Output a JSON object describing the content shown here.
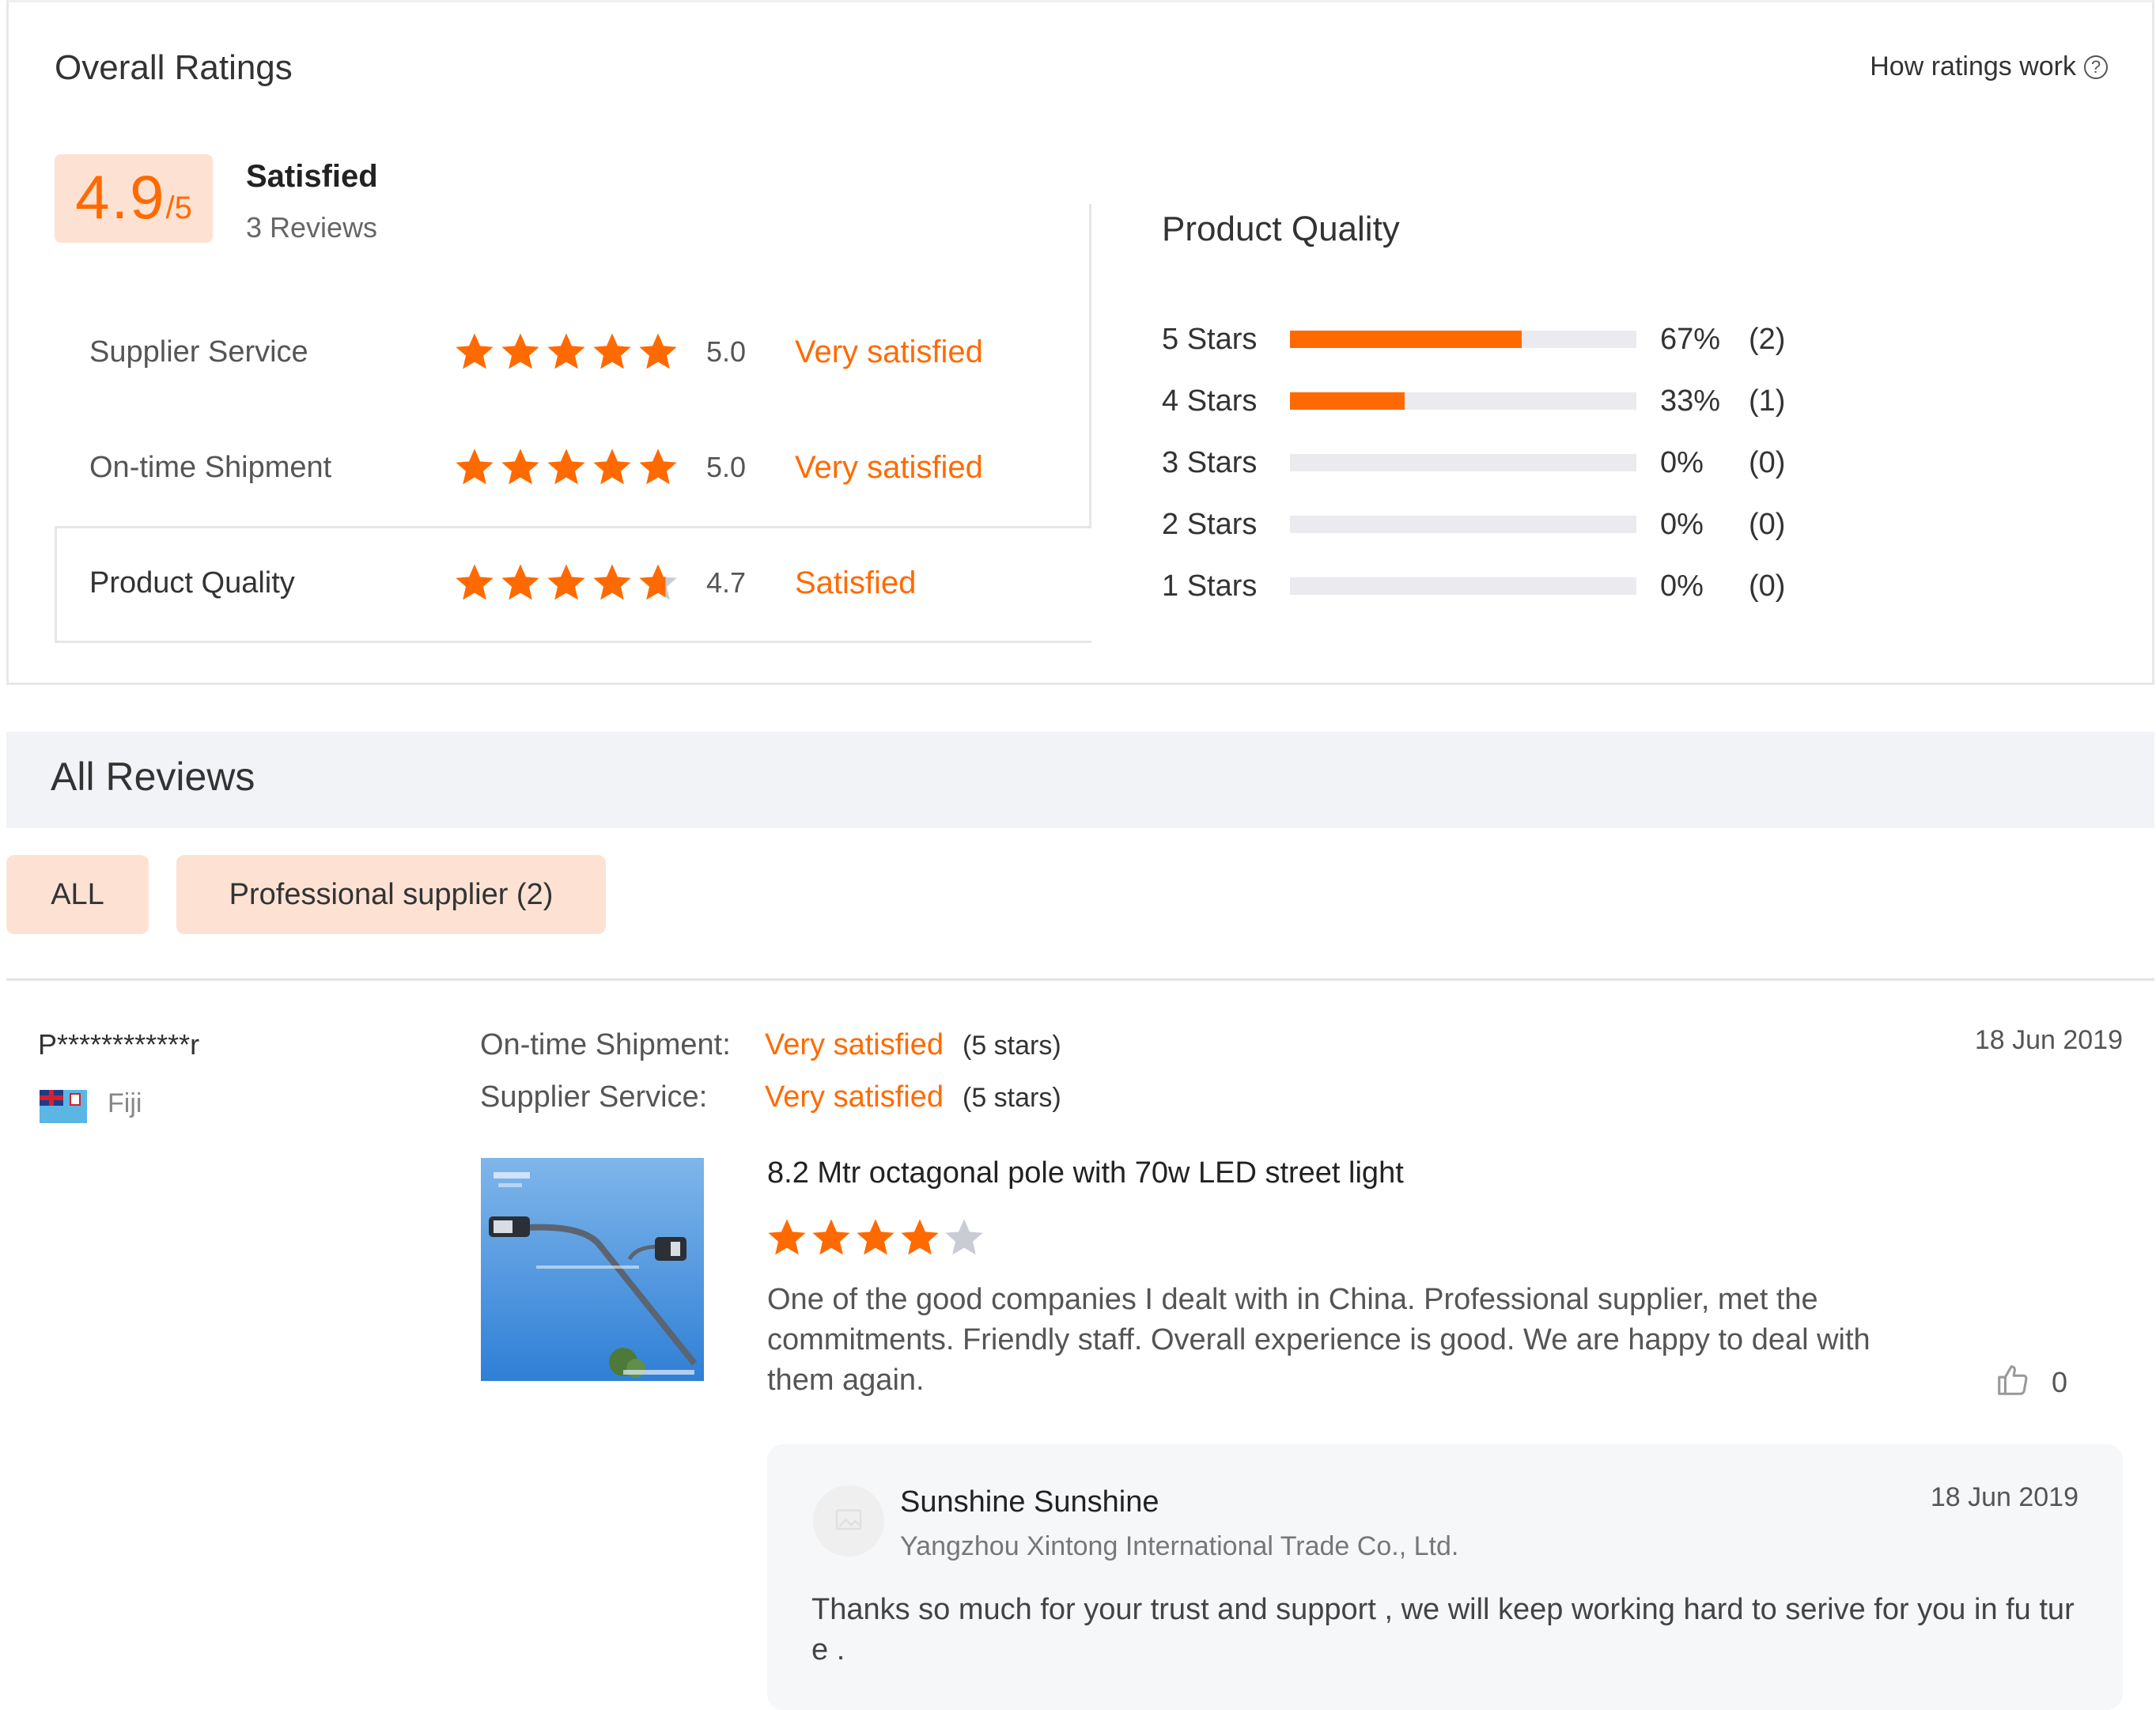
{
  "overall": {
    "title": "Overall Ratings",
    "how_link": "How ratings work",
    "help_icon": "?",
    "score": "4.9",
    "score_max": "/5",
    "score_label": "Satisfied",
    "review_count": "3 Reviews",
    "accent_color": "#ff6a00",
    "badge_color": "#fde2d3"
  },
  "ratings": [
    {
      "label": "Supplier Service",
      "stars": 5.0,
      "value": "5.0",
      "text": "Very satisfied"
    },
    {
      "label": "On-time Shipment",
      "stars": 5.0,
      "value": "5.0",
      "text": "Very satisfied"
    },
    {
      "label": "Product Quality",
      "stars": 4.7,
      "value": "4.7",
      "text": "Satisfied"
    }
  ],
  "product_quality": {
    "title": "Product Quality",
    "distribution": [
      {
        "label": "5 Stars",
        "fraction": 0.67,
        "pct": "67%",
        "count": "(2)"
      },
      {
        "label": "4 Stars",
        "fraction": 0.33,
        "pct": "33%",
        "count": "(1)"
      },
      {
        "label": "3 Stars",
        "fraction": 0,
        "pct": "0%",
        "count": "(0)"
      },
      {
        "label": "2 Stars",
        "fraction": 0,
        "pct": "0%",
        "count": "(0)"
      },
      {
        "label": "1 Stars",
        "fraction": 0,
        "pct": "0%",
        "count": "(0)"
      }
    ]
  },
  "all_reviews": {
    "title": "All Reviews",
    "filters": [
      {
        "label": "ALL"
      },
      {
        "label": "Professional supplier (2)"
      }
    ]
  },
  "review": {
    "reviewer": "P************r",
    "country": "Fiji",
    "flag_icon": "fiji-flag",
    "date": "18 Jun 2019",
    "sub_ratings": [
      {
        "label": "On-time Shipment:",
        "value": "Very satisfied",
        "stars": "(5 stars)"
      },
      {
        "label": "Supplier Service:",
        "value": "Very satisfied",
        "stars": "(5 stars)"
      }
    ],
    "product_title": "8.2 Mtr octagonal pole with 70w LED street light",
    "product_stars": 4,
    "text": "One of the good companies I dealt with in China. Professional supplier, met the commitments. Friendly staff. Overall experience is good. We are happy to deal with them again.",
    "likes": "0",
    "reply": {
      "name": "Sunshine Sunshine",
      "company": "Yangzhou Xintong International Trade Co., Ltd.",
      "date": "18 Jun 2019",
      "text": "Thanks so much for your trust and support , we will keep working hard to serive for you in fu ture ."
    }
  }
}
